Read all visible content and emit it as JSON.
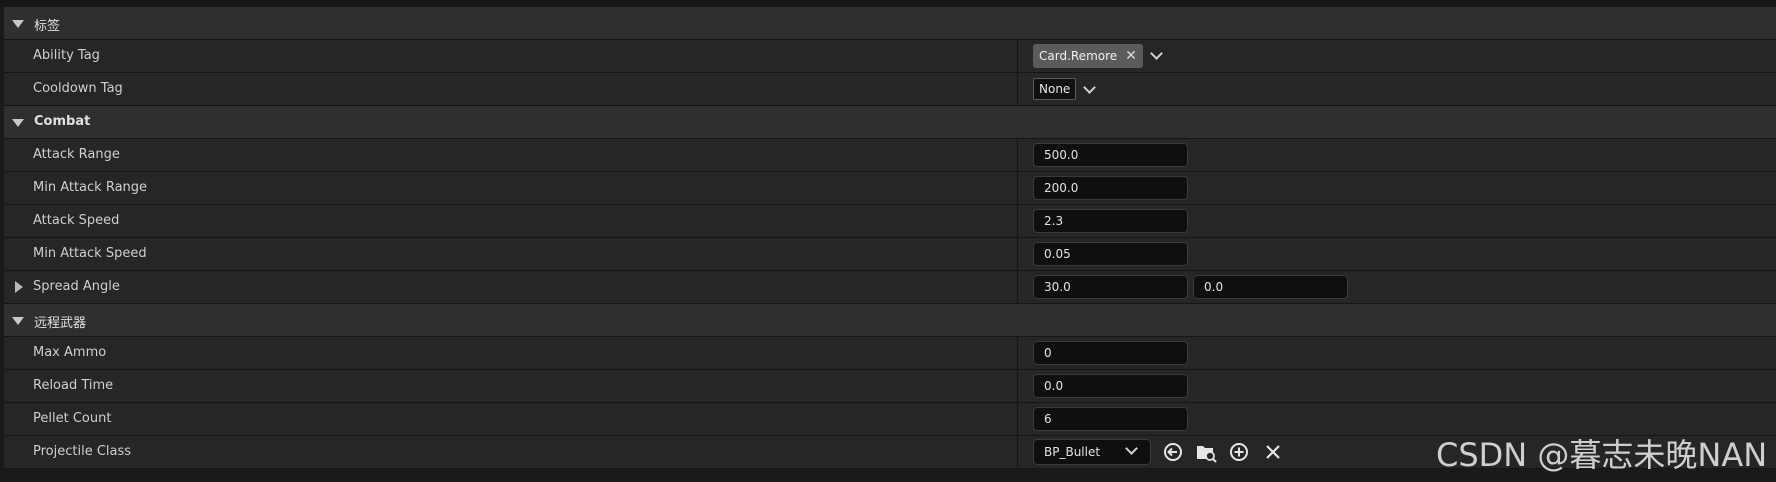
{
  "categories": {
    "tags": {
      "title": "标签"
    },
    "combat": {
      "title": "Combat"
    },
    "ranged": {
      "title": "远程武器"
    }
  },
  "properties": {
    "ability_tag": {
      "label": "Ability Tag",
      "value": "Card.Remore"
    },
    "cooldown_tag": {
      "label": "Cooldown Tag",
      "value": "None"
    },
    "attack_range": {
      "label": "Attack Range",
      "value": "500.0"
    },
    "min_attack_range": {
      "label": "Min Attack Range",
      "value": "200.0"
    },
    "attack_speed": {
      "label": "Attack Speed",
      "value": "2.3"
    },
    "min_attack_speed": {
      "label": "Min Attack Speed",
      "value": "0.05"
    },
    "spread_angle": {
      "label": "Spread Angle",
      "value_x": "30.0",
      "value_y": "0.0"
    },
    "max_ammo": {
      "label": "Max Ammo",
      "value": "0"
    },
    "reload_time": {
      "label": "Reload Time",
      "value": "0.0"
    },
    "pellet_count": {
      "label": "Pellet Count",
      "value": "6"
    },
    "projectile_class": {
      "label": "Projectile Class",
      "value": "BP_Bullet"
    }
  },
  "icons": {
    "use_selected": "arrow-circle-left-icon",
    "browse": "folder-search-icon",
    "add": "plus-circle-icon",
    "clear": "close-icon"
  },
  "watermark": "CSDN @暮志未晚NAN",
  "colors": {
    "category_bg": "#2f2f2f",
    "property_bg": "#262626",
    "input_bg": "#0f0f0f",
    "tag_chip_bg": "#5b5b5b"
  }
}
